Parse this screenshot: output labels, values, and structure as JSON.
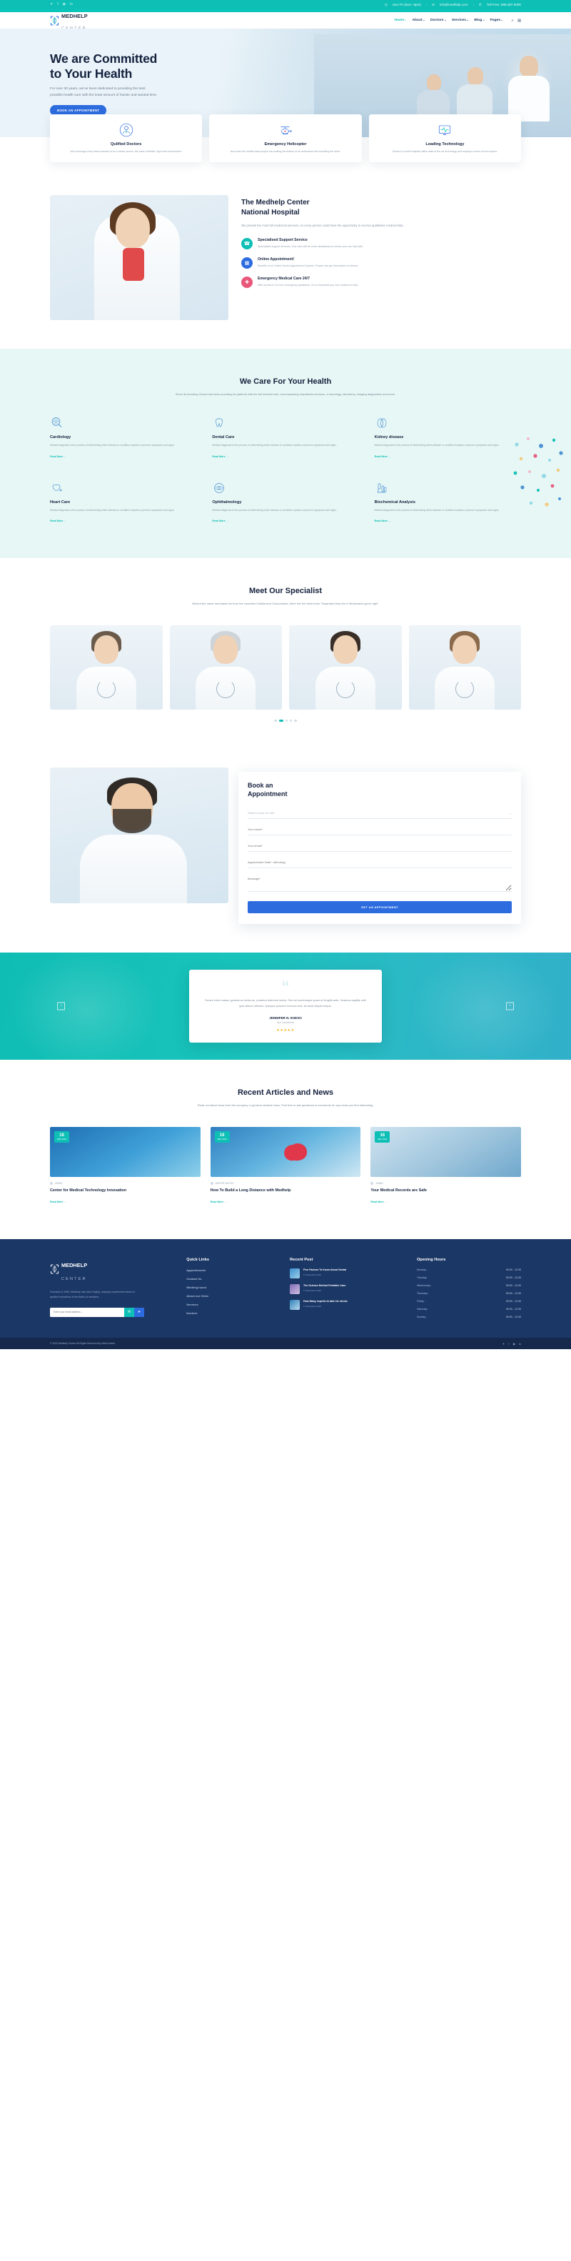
{
  "topbar": {
    "social": [
      "twitter-icon",
      "facebook-icon",
      "instagram-icon",
      "linkedin-icon"
    ],
    "hours": "Sun-Fri (9am -6pm)",
    "email": "info@medhelp.com",
    "phone": "Toll Free: 888.387.5000",
    "sep": "|"
  },
  "brand": {
    "line1": "MEDHELP",
    "line2": "CENTER"
  },
  "nav": {
    "items": [
      {
        "label": "Home",
        "caret": true,
        "active": true
      },
      {
        "label": "About",
        "caret": true,
        "active": false
      },
      {
        "label": "Doctors",
        "caret": true,
        "active": false
      },
      {
        "label": "Services",
        "caret": true,
        "active": false
      },
      {
        "label": "Blog",
        "caret": true,
        "active": false
      },
      {
        "label": "Pages",
        "caret": true,
        "active": false
      }
    ],
    "search_icon": "search-icon",
    "cart_icon": "cart-icon"
  },
  "hero": {
    "title_line1": "We are Committed",
    "title_line2": "to Your Health",
    "body": "For over 30 years, we've been dedicated to providing the best possible health care with the least amount of hassle and wasted time.",
    "cta": "BOOK AN APPOINTMENT"
  },
  "features": [
    {
      "icon": "doctor-badge-icon",
      "title": "Qulified Doctors",
      "text": "We encourage every team member to be a whole person. We have a flexible, high trust environment."
    },
    {
      "icon": "helicopter-icon",
      "title": "Emergency Helicopter",
      "text": "Now even the middle class people are availing the feature of air ambulance and travelling the world."
    },
    {
      "icon": "monitor-pulse-icon",
      "title": "Leading Technology",
      "text": "Genea is a world hospital utilize state of the art technology and employs a team of true experts."
    }
  ],
  "about": {
    "title_line1": "The Medhelp Center",
    "title_line2": "National Hospital",
    "body": "We provide the most full medicinal services, so every person could have the opportunity to receive qualitative medical help.",
    "items": [
      {
        "icon": "headset-icon",
        "color": "#0dbfb5",
        "title": "Specialised Support Service",
        "text": "Specialised support services. Your care will be much disciplinary to ensure you can help with."
      },
      {
        "icon": "calendar-check-icon",
        "color": "#2d6cdf",
        "title": "Online Appointment!",
        "text": "Benefits of an Online Doctor Appointment System. People can get information of doctors."
      },
      {
        "icon": "ambulance-icon",
        "color": "#e8577a",
        "title": "Emergency Medical Care 24/7",
        "text": "With access to 24 hour emergency assistance, it's so important you can continue to help."
      }
    ]
  },
  "care": {
    "title": "We Care For Your Health",
    "subtitle": "Since its founding Genea has been providing its patients with the full medical care, encompassing outpatients services, a neurology, laboratory, imaging diagnostics and more.",
    "readmore": "Read More →",
    "services": [
      {
        "icon": "heart-search-icon",
        "title": "Cardiology",
        "text": "Medical diagnosis is the process of determining which disease or condition explains a person's symptoms and signs."
      },
      {
        "icon": "tooth-icon",
        "title": "Dental Care",
        "text": "Medical diagnosis is the process of determining which disease or condition explains a person's symptoms and signs."
      },
      {
        "icon": "kidney-icon",
        "title": "Kidney disease",
        "text": "Medical diagnosis is the process of determining which disease or condition explains a person's symptoms and signs."
      },
      {
        "icon": "heart-care-icon",
        "title": "Heart Care",
        "text": "Medical diagnosis is the process of determining which disease or condition explains a person's symptoms and signs."
      },
      {
        "icon": "eye-icon",
        "title": "Ophthalmology",
        "text": "Medical diagnosis is the process of determining which disease or condition explains a person's symptoms and signs."
      },
      {
        "icon": "microscope-icon",
        "title": "Biochemical Analysis",
        "text": "Medical diagnosis is the process of determining which disease or condition explains a person's symptoms and signs."
      }
    ]
  },
  "specialists": {
    "title": "Meet Our Specialist",
    "subtitle": "Behind the name mountains far from the countries Vokalia and Consonantia, there live the blind texts. Separated they live in Bookmarks grove right.",
    "cards": [
      {
        "name": "specialist-card-1",
        "hair": "#6b5a4a"
      },
      {
        "name": "specialist-card-2",
        "hair": "#cfd4d8"
      },
      {
        "name": "specialist-card-3",
        "hair": "#3a2f28"
      },
      {
        "name": "specialist-card-4",
        "hair": "#8a6a4a"
      }
    ],
    "dots": [
      false,
      true,
      false,
      false,
      false
    ]
  },
  "appointment": {
    "title_line1": "Book an",
    "title_line2": "Appointment",
    "fields": [
      {
        "name": "doctor-select",
        "placeholder": "Select doctor for visit",
        "type": "select"
      },
      {
        "name": "name-field",
        "placeholder": "Your name*",
        "type": "text"
      },
      {
        "name": "email-field",
        "placeholder": "Your email*",
        "type": "text"
      },
      {
        "name": "date-field",
        "placeholder": "Appointment Date*: dd/mm/yy",
        "type": "text"
      },
      {
        "name": "message-field",
        "placeholder": "Message*",
        "type": "textarea"
      }
    ],
    "submit": "GET AN APPOINTMENT"
  },
  "testimonial": {
    "quote_mark": "“",
    "text": "Donec enim massa, gravida ac lectus ac, pharetra interdum lectus. Sed vel scelerisque quam at fringilla ante. Vivamus sagittis velit quis dictum ultricies. Quisque posuere rhoncus erat, sit amet aliquet neque.",
    "name": "JENNIFER N. ESESO",
    "role": "Our Coustemer",
    "stars": "★★★★★",
    "prev": "‹",
    "next": "›"
  },
  "news": {
    "title": "Recent Articles and News",
    "subtitle": "Read our latest news from the company or general medical news. Feel free to ask questions in comments for any news you find interesting.",
    "readmore": "Read More →",
    "posts": [
      {
        "day": "16",
        "month": "DEC 2019",
        "author": "ADMIN",
        "category": "",
        "title": "Center for Medical Technology Innovation"
      },
      {
        "day": "16",
        "month": "DEC 2019",
        "author": "WINTER WHITES",
        "category": "",
        "title": "How To Build a Long Distance with Medhelp"
      },
      {
        "day": "16",
        "month": "DEC 2019",
        "author": "ADMIN",
        "category": "",
        "title": "Your Medical Records are Safe"
      }
    ]
  },
  "footer": {
    "about": "Founded in 1990, Medhelp has had a highly, uniquely experienced team of quafied executives in the fields of medicine.",
    "newsletter_placeholder": "Enter your email address...",
    "newsletter_icon1": "envelope-icon",
    "newsletter_icon2": "send-icon",
    "quicklinks_title": "Quick Links",
    "quicklinks": [
      "Appointments",
      "Contact Us",
      "Working hours",
      "About our Clinic",
      "Services",
      "Doctors"
    ],
    "recentpost_title": "Recent Post",
    "posts": [
      {
        "title": "Five Factors To Know About Dental",
        "date": "17 December 2019"
      },
      {
        "title": "The Science Behind Pediatric Care",
        "date": "17 December 2019"
      },
      {
        "title": "How Many experts to take for stroke",
        "date": "17 December 2019"
      }
    ],
    "hours_title": "Opening Hours",
    "hours": [
      {
        "day": "Monday :",
        "time": "09.00 - 12.00"
      },
      {
        "day": "Tuesday :",
        "time": "09.00 - 12.00"
      },
      {
        "day": "Wednesday :",
        "time": "09.00 - 12.00"
      },
      {
        "day": "Thursday :",
        "time": "09.00 - 12.00"
      },
      {
        "day": "Friday :",
        "time": "09.00 - 12.00"
      },
      {
        "day": "Saturday :",
        "time": "09.00 - 12.00"
      },
      {
        "day": "Sunday :",
        "time": "09.00 - 12.00"
      }
    ],
    "copyright": "© 2020 Medhelp Center All Rights Reserved By WebContent",
    "social": [
      "twitter-icon",
      "facebook-icon",
      "instagram-icon",
      "linkedin-icon"
    ]
  }
}
